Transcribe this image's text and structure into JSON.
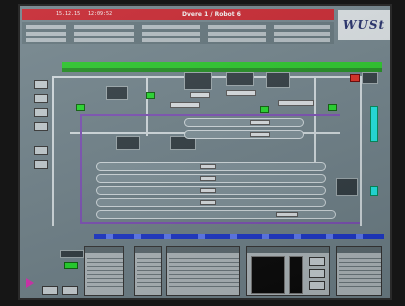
{
  "window": {
    "date": "15.12.15",
    "clock": "12:09:52",
    "title": "Dvere 1 / Robot 6"
  },
  "brand": {
    "logo_text": "WUSt"
  },
  "colors": {
    "title_bar": "#c4212b",
    "screen_bg": "#6e8088",
    "alarm_green": "#27c427",
    "accent_cyan": "#1ee4e0",
    "conveyor_blue": "#1c36c8"
  },
  "icons": [
    "play-icon"
  ]
}
